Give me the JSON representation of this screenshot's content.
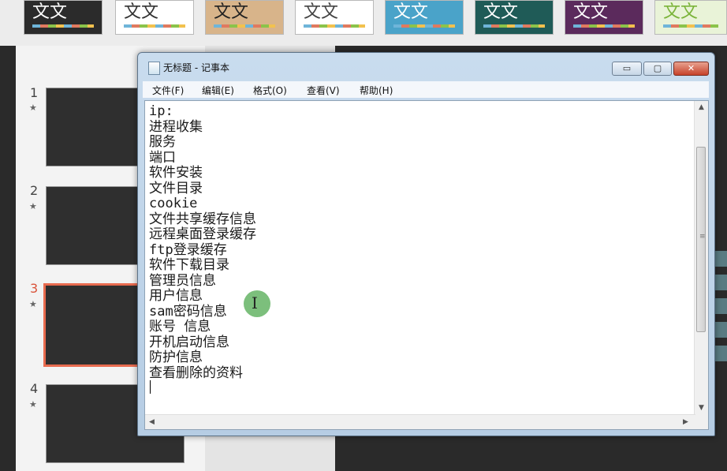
{
  "theme_gallery": {
    "items": [
      {
        "label": "文文",
        "bg": "#2b2b2b"
      },
      {
        "label": "文文",
        "bg": "#ffffff"
      },
      {
        "label": "文文",
        "bg": "#d8b48a"
      },
      {
        "label": "文文",
        "bg": "#ffffff"
      },
      {
        "label": "文文",
        "bg": "#4aa3c9"
      },
      {
        "label": "文文",
        "bg": "#1f5b57"
      },
      {
        "label": "文文",
        "bg": "#5b2a5c"
      },
      {
        "label": "文文",
        "bg": "#e9f3d8"
      }
    ]
  },
  "slides": {
    "items": [
      {
        "number": "1"
      },
      {
        "number": "2"
      },
      {
        "number": "3"
      },
      {
        "number": "4"
      }
    ],
    "star": "★"
  },
  "notepad": {
    "title": "无标题 - 记事本",
    "buttons": {
      "minimize": "▭",
      "maximize": "▢",
      "close": "✕"
    },
    "menu": [
      {
        "label": "文件(F)"
      },
      {
        "label": "编辑(E)"
      },
      {
        "label": "格式(O)"
      },
      {
        "label": "查看(V)"
      },
      {
        "label": "帮助(H)"
      }
    ],
    "lines": [
      "ip:",
      "进程收集",
      "服务",
      "端口",
      "软件安装",
      "文件目录",
      "cookie",
      "文件共享缓存信息",
      "远程桌面登录缓存",
      "ftp登录缓存",
      "软件下载目录",
      "管理员信息",
      "用户信息",
      "sam密码信息",
      "账号 信息",
      "开机启动信息",
      "防护信息",
      "查看删除的资料"
    ],
    "scrollbar": {
      "up": "▲",
      "down": "▼",
      "left": "◀",
      "right": "▶",
      "grip": "≡"
    }
  },
  "cursor": {
    "ibeam": "I"
  }
}
